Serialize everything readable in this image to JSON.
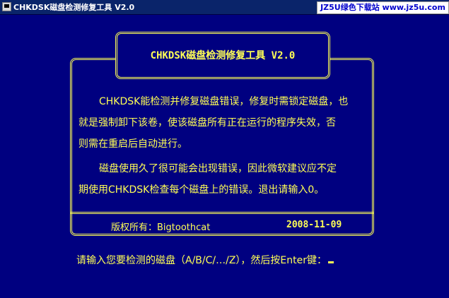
{
  "window": {
    "title": "CHKDSK磁盘检测修复工具 V2.0",
    "watermark": "JZ5U绿色下载站 www.jz5u.com"
  },
  "banner": {
    "title": "CHKDSK磁盘检测修复工具 V2.0"
  },
  "description": {
    "line1": "CHKDSK能检测并修复磁盘错误，修复时需锁定磁盘，也",
    "line2": "就是强制卸下该卷，使该磁盘所有正在运行的程序失效，否",
    "line3": "则需在重启后自动进行。",
    "line4": "磁盘使用久了很可能会出现错误，因此微软建议应不定",
    "line5": "期使用CHKDSK检查每个磁盘上的错误。退出请输入0。"
  },
  "footer": {
    "copyright": "版权所有：Bigtoothcat",
    "date": "2008-11-09"
  },
  "prompt": {
    "text": "请输入您要检测的磁盘（A/B/C/…/Z），然后按Enter键："
  },
  "colors": {
    "background": "#000080",
    "foreground": "#ffff55",
    "titlebar": "#0a246a"
  }
}
